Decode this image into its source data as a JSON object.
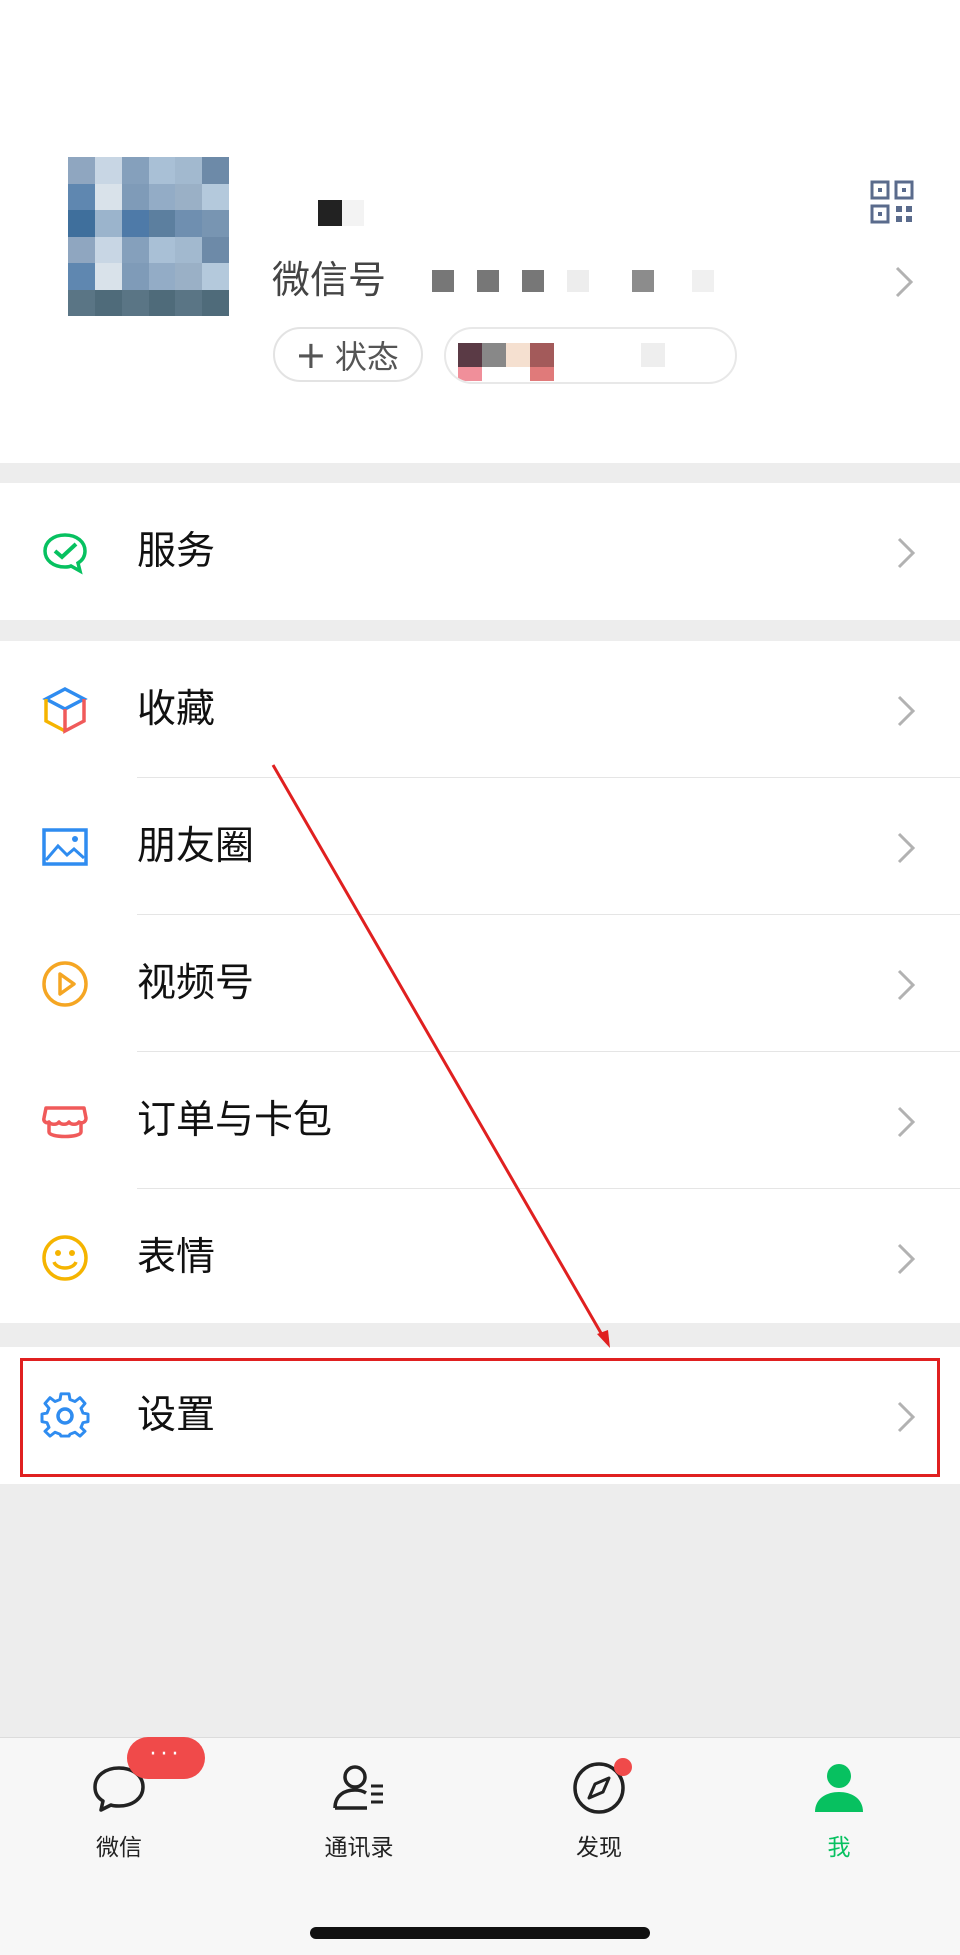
{
  "profile": {
    "wechat_id_label": "微信号",
    "status_button": "状态",
    "status_plus": "+"
  },
  "menu": {
    "services": "服务",
    "favorites": "收藏",
    "moments": "朋友圈",
    "channels": "视频号",
    "orders_cards": "订单与卡包",
    "stickers": "表情",
    "settings": "设置"
  },
  "tabbar": {
    "tabs": [
      {
        "label": "微信",
        "icon": "chat-bubble-icon"
      },
      {
        "label": "通讯录",
        "icon": "contacts-icon"
      },
      {
        "label": "发现",
        "icon": "compass-icon"
      },
      {
        "label": "我",
        "icon": "person-icon"
      }
    ],
    "active": "我",
    "chat_badge": "···"
  },
  "colors": {
    "brand_green": "#07c160",
    "badge_red": "#f04a4a",
    "annotation_red": "#e02020",
    "background": "#ededed"
  }
}
